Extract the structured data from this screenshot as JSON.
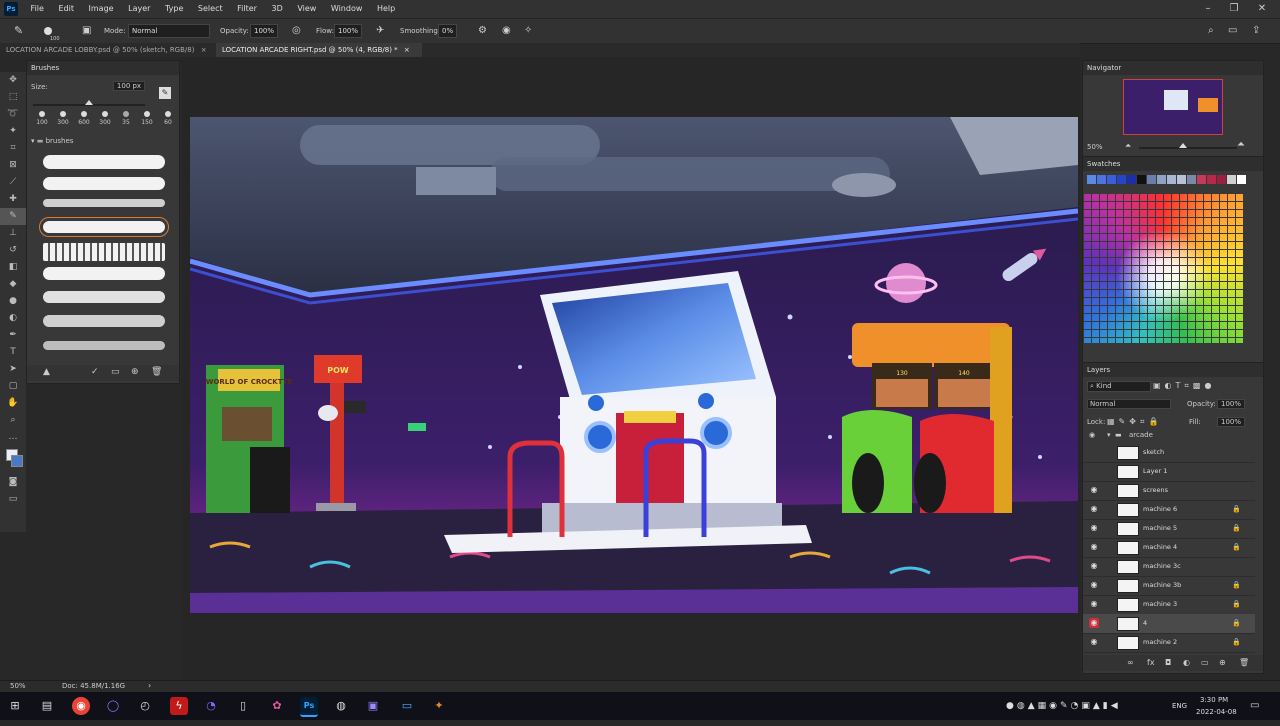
{
  "menubar": {
    "logo": "Ps",
    "items": [
      "File",
      "Edit",
      "Image",
      "Layer",
      "Type",
      "Select",
      "Filter",
      "3D",
      "View",
      "Window",
      "Help"
    ],
    "window_controls": [
      "–",
      "❐",
      "✕"
    ]
  },
  "options": {
    "brush_size": "100",
    "mode_label": "Mode:",
    "mode_value": "Normal",
    "opacity_label": "Opacity:",
    "opacity_value": "100%",
    "flow_label": "Flow:",
    "flow_value": "100%",
    "smoothing_label": "Smoothing:",
    "smoothing_value": "0%"
  },
  "tabs": [
    {
      "label": "LOCATION ARCADE LOBBY.psd @ 50% (sketch, RGB/8)",
      "close": "×"
    },
    {
      "label": "LOCATION ARCADE RIGHT.psd @ 50% (4, RGB/8) *",
      "close": "×"
    }
  ],
  "brushes_panel": {
    "title": "Brushes",
    "size_label": "Size:",
    "size_value": "100 px",
    "presets": [
      "100",
      "300",
      "600",
      "300",
      "35",
      "150",
      "60"
    ],
    "folder": "brushes"
  },
  "navigator": {
    "title": "Navigator",
    "zoom": "50%"
  },
  "swatches": {
    "title": "Swatches",
    "colors": [
      "#5b8ae6",
      "#4b74e0",
      "#3a5fd8",
      "#2346c8",
      "#1a2fa8",
      "#111111",
      "#6b7eaa",
      "#8fa1c6",
      "#a8b6d4",
      "#b7c2d9",
      "#7a8aa6",
      "#c43a5c",
      "#b8284a",
      "#9a2040",
      "#d0d0d0",
      "#ffffff"
    ]
  },
  "layers": {
    "title": "Layers",
    "kind": "Kind",
    "blend_mode": "Normal",
    "opacity_label": "Opacity:",
    "opacity_value": "100%",
    "lock_label": "Lock:",
    "fill_label": "Fill:",
    "fill_value": "100%",
    "group": "arcade",
    "rows": [
      {
        "name": "sketch",
        "visible": false,
        "locked": false
      },
      {
        "name": "Layer 1",
        "visible": false,
        "locked": false
      },
      {
        "name": "screens",
        "visible": true,
        "locked": false
      },
      {
        "name": "machine 6",
        "visible": true,
        "locked": true
      },
      {
        "name": "machine 5",
        "visible": true,
        "locked": true
      },
      {
        "name": "machine 4",
        "visible": true,
        "locked": true
      },
      {
        "name": "machine 3c",
        "visible": true,
        "locked": false
      },
      {
        "name": "machine 3b",
        "visible": true,
        "locked": true
      },
      {
        "name": "machine 3",
        "visible": true,
        "locked": true
      },
      {
        "name": "4",
        "visible": true,
        "locked": true,
        "active": true
      },
      {
        "name": "machine 2",
        "visible": true,
        "locked": true
      }
    ]
  },
  "status": {
    "zoom": "50%",
    "doc": "Doc: 45.8M/1.16G",
    "arrow": "›"
  },
  "artwork": {
    "cabinet_left_marquee": "WORLD OF CROCKTTE",
    "cabinet_pow": "POW",
    "racer_left_score": "130",
    "racer_right_score": "140"
  },
  "taskbar": {
    "language": "ENG",
    "time": "3:30 PM",
    "date": "2022-04-08"
  },
  "colors": {
    "photoshop_blue": "#31a8ff",
    "panel_bg": "#383838",
    "active_layer_eye": "#d02c3c"
  }
}
